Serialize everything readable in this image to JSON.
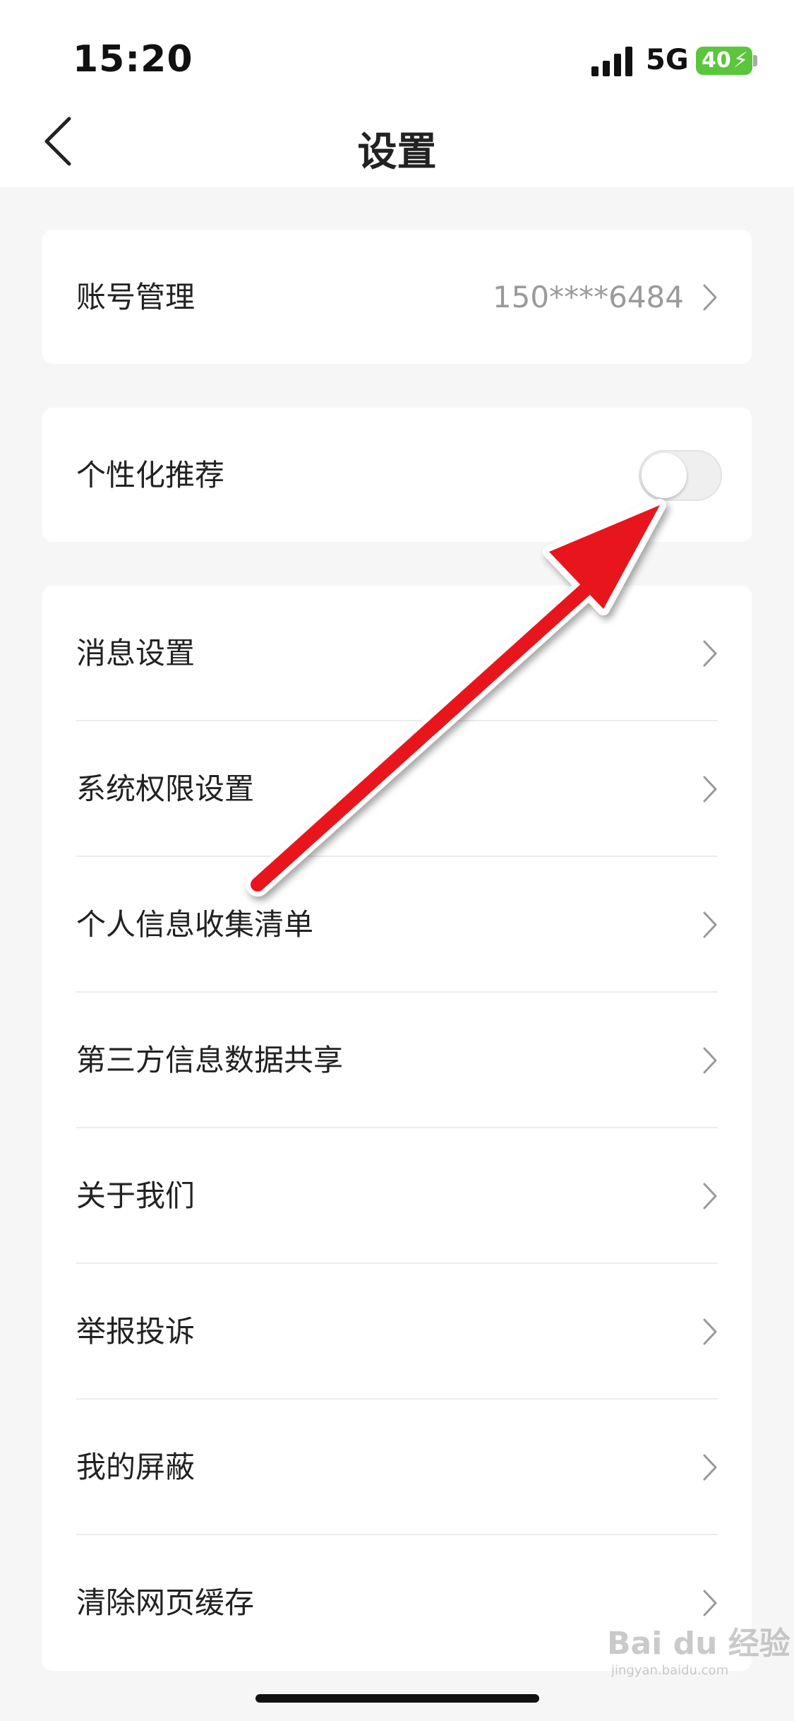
{
  "status_bar": {
    "time": "15:20",
    "network": "5G",
    "battery": "40"
  },
  "nav": {
    "title": "设置"
  },
  "account": {
    "label": "账号管理",
    "value": "150****6484"
  },
  "recommend": {
    "label": "个性化推荐",
    "enabled": false
  },
  "menu": [
    {
      "label": "消息设置"
    },
    {
      "label": "系统权限设置"
    },
    {
      "label": "个人信息收集清单"
    },
    {
      "label": "第三方信息数据共享"
    },
    {
      "label": "关于我们"
    },
    {
      "label": "举报投诉"
    },
    {
      "label": "我的屏蔽"
    },
    {
      "label": "清除网页缓存"
    }
  ],
  "colors": {
    "accent_annotation": "#e8141c",
    "battery": "#5ac63c"
  },
  "watermark": {
    "brand": "Bai du 经验",
    "url": "jingyan.baidu.com"
  }
}
